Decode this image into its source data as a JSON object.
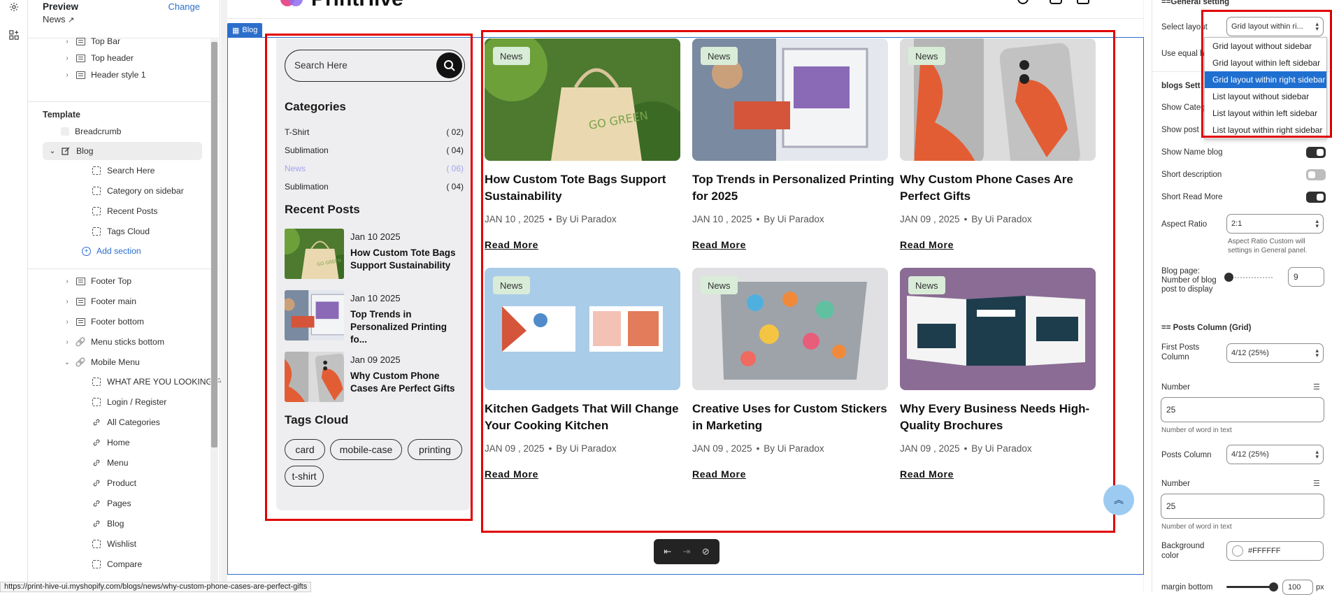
{
  "app": {
    "left_rail": [
      "gear-icon",
      "apps-icon"
    ]
  },
  "sidebar": {
    "preview_title": "Preview",
    "change": "Change",
    "preview_page": "News",
    "header_items": [
      {
        "label": "Top Bar"
      },
      {
        "label": "Top header"
      },
      {
        "label": "Header style 1"
      }
    ],
    "template_title": "Template",
    "breadcrumb": "Breadcrumb",
    "blog": "Blog",
    "blog_children": [
      "Search Here",
      "Category on sidebar",
      "Recent Posts",
      "Tags Cloud"
    ],
    "add_section": "Add section",
    "footer_items": [
      {
        "label": "Footer Top"
      },
      {
        "label": "Footer main"
      },
      {
        "label": "Footer bottom"
      },
      {
        "label": "Menu sticks bottom"
      },
      {
        "label": "Mobile Menu"
      }
    ],
    "mobile_children": [
      {
        "label": "WHAT ARE YOU LOOKING FOR?",
        "icon": "section"
      },
      {
        "label": "Login / Register",
        "icon": "section"
      },
      {
        "label": "All Categories",
        "icon": "link"
      },
      {
        "label": "Home",
        "icon": "link"
      },
      {
        "label": "Menu",
        "icon": "link"
      },
      {
        "label": "Product",
        "icon": "link"
      },
      {
        "label": "Pages",
        "icon": "link"
      },
      {
        "label": "Blog",
        "icon": "link"
      },
      {
        "label": "Wishlist",
        "icon": "section"
      },
      {
        "label": "Compare",
        "icon": "section"
      }
    ]
  },
  "preview": {
    "logo": "PrintHive",
    "section_tag": "Blog",
    "search_placeholder": "Search Here",
    "categories_title": "Categories",
    "categories": [
      {
        "name": "T-Shirt",
        "count": "( 02)"
      },
      {
        "name": "Sublimation",
        "count": "( 04)"
      },
      {
        "name": "News",
        "count": "( 06)",
        "active": true
      },
      {
        "name": "Sublimation",
        "count": "( 04)"
      }
    ],
    "recent_title": "Recent Posts",
    "recent_posts": [
      {
        "date": "Jan 10 2025",
        "title": "How Custom Tote Bags Support Sustainability"
      },
      {
        "date": "Jan 10 2025",
        "title": "Top Trends in Personalized Printing fo..."
      },
      {
        "date": "Jan 09 2025",
        "title": "Why Custom Phone Cases Are Perfect Gifts"
      }
    ],
    "tags_title": "Tags Cloud",
    "tags": [
      "card",
      "mobile-case",
      "printing",
      "t-shirt"
    ],
    "read_more": "Read More",
    "posts": [
      {
        "badge": "News",
        "title": "How Custom Tote Bags Support Sustainability",
        "date": "JAN 10 , 2025",
        "author": "By Ui Paradox"
      },
      {
        "badge": "News",
        "title": "Top Trends in Personalized Printing for 2025",
        "date": "JAN 10 , 2025",
        "author": "By Ui Paradox"
      },
      {
        "badge": "News",
        "title": "Why Custom Phone Cases Are Perfect Gifts",
        "date": "JAN 09 , 2025",
        "author": "By Ui Paradox"
      },
      {
        "badge": "News",
        "title": "Kitchen Gadgets That Will Change Your Cooking Kitchen",
        "date": "JAN 09 , 2025",
        "author": "By Ui Paradox"
      },
      {
        "badge": "News",
        "title": "Creative Uses for Custom Stickers in Marketing",
        "date": "JAN 09 , 2025",
        "author": "By Ui Paradox"
      },
      {
        "badge": "News",
        "title": "Why Every Business Needs High-Quality Brochures",
        "date": "JAN 09 , 2025",
        "author": "By Ui Paradox"
      }
    ],
    "tote_text": "GO GREEN",
    "status_url": "https://print-hive-ui.myshopify.com/blogs/news/why-custom-phone-cases-are-perfect-gifts"
  },
  "settings": {
    "general_heading": "==General setting",
    "select_layout_label": "Select layout",
    "select_layout_value": "Grid layout within ri...",
    "use_equal_label": "Use equal h",
    "layout_options": [
      "Grid layout without sidebar",
      "Grid layout within left sidebar",
      "Grid layout within right sidebar",
      "List layout without sidebar",
      "List layout within left sidebar",
      "List layout within right sidebar"
    ],
    "layout_selected_index": 2,
    "blogs_heading": "blogs Sett",
    "show_category_label": "Show Categ",
    "show_post_label": "Show post",
    "show_name_label": "Show Name blog",
    "short_desc_label": "Short description",
    "short_read_more_label": "Short Read More",
    "toggles": {
      "show_name": true,
      "short_description": false,
      "short_read_more": true
    },
    "aspect_ratio_label": "Aspect Ratio",
    "aspect_ratio_value": "2:1",
    "aspect_hint": "Aspect Ratio Custom will settings in General panel.",
    "blog_page_label": "Blog page: Number of blog post to display",
    "blog_page_value": "9",
    "blog_page_slider": 0.05,
    "posts_column_heading": "== Posts Column (Grid)",
    "first_posts_label": "First Posts Column",
    "first_posts_value": "4/12 (25%)",
    "number_label": "Number",
    "number_value_1": "25",
    "number_hint": "Number of word in text",
    "posts_column_label": "Posts Column",
    "posts_column_value": "4/12 (25%)",
    "number_value_2": "25",
    "bg_color_label": "Background color",
    "bg_color_value": "#FFFFFF",
    "margin_bottom_label": "margin bottom",
    "margin_bottom_value": "100",
    "margin_bottom_unit": "px",
    "margin_bottom_slider": 0.95
  },
  "colors": {
    "accent": "#2c6ecb",
    "highlight_red": "#e00000",
    "badge_bg": "#d8ecd8",
    "widget_bg": "#eeeef0",
    "dropdown_selected": "#1f6fd0"
  }
}
